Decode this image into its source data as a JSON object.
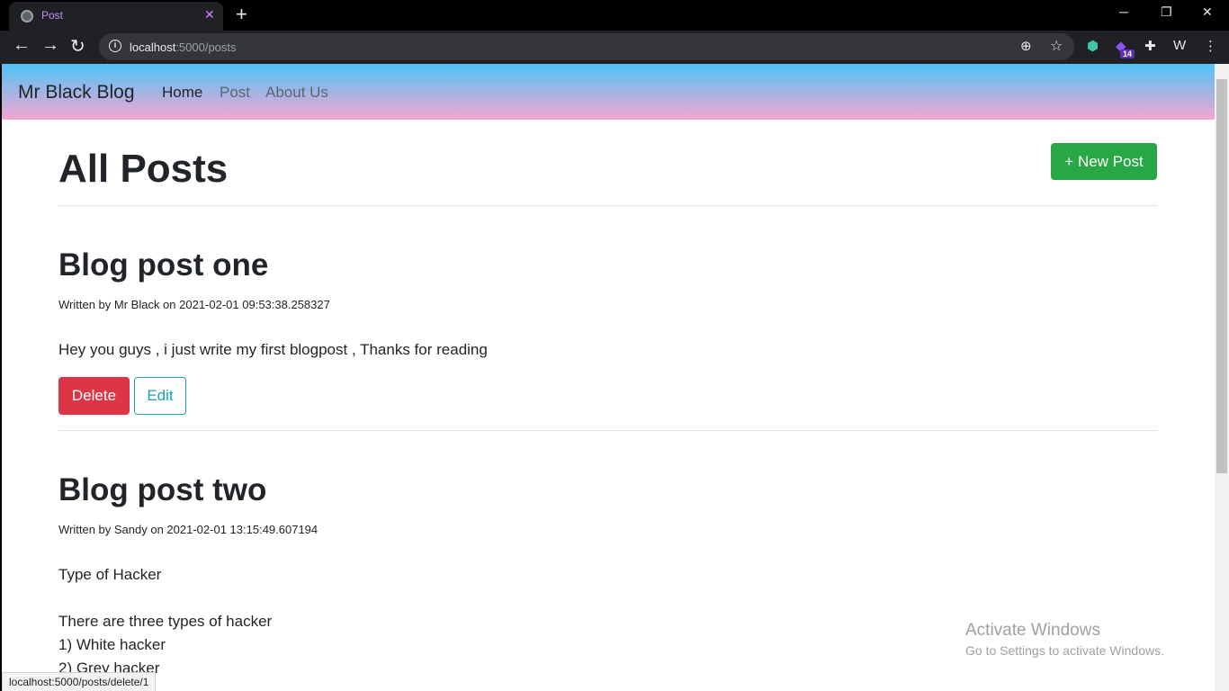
{
  "browser": {
    "tab_title": "Post",
    "url_host": "localhost",
    "url_path": ":5000/posts",
    "status_url": "localhost:5000/posts/delete/1",
    "extension_badge": "14"
  },
  "navbar": {
    "brand": "Mr Black Blog",
    "links": [
      {
        "label": "Home",
        "active": true
      },
      {
        "label": "Post",
        "active": false
      },
      {
        "label": "About Us",
        "active": false
      }
    ]
  },
  "page": {
    "heading": "All Posts",
    "new_post_label": "+ New Post"
  },
  "posts": [
    {
      "title": "Blog post one",
      "meta": "Written by Mr Black on 2021-02-01 09:53:38.258327",
      "body": [
        "Hey you guys , i just write my first blogpost , Thanks for reading"
      ],
      "delete_label": "Delete",
      "edit_label": "Edit"
    },
    {
      "title": "Blog post two",
      "meta": "Written by Sandy on 2021-02-01 13:15:49.607194",
      "body": [
        "Type of Hacker",
        "There are three types of hacker",
        "1) White hacker",
        "2) Grey hacker"
      ]
    }
  ],
  "watermark": {
    "line1": "Activate Windows",
    "line2": "Go to Settings to activate Windows."
  },
  "colors": {
    "success": "#28a745",
    "danger": "#dc3545",
    "info": "#17a2b8",
    "navbar_top": "#4fc3f7",
    "navbar_bottom": "#f5a6d0"
  }
}
